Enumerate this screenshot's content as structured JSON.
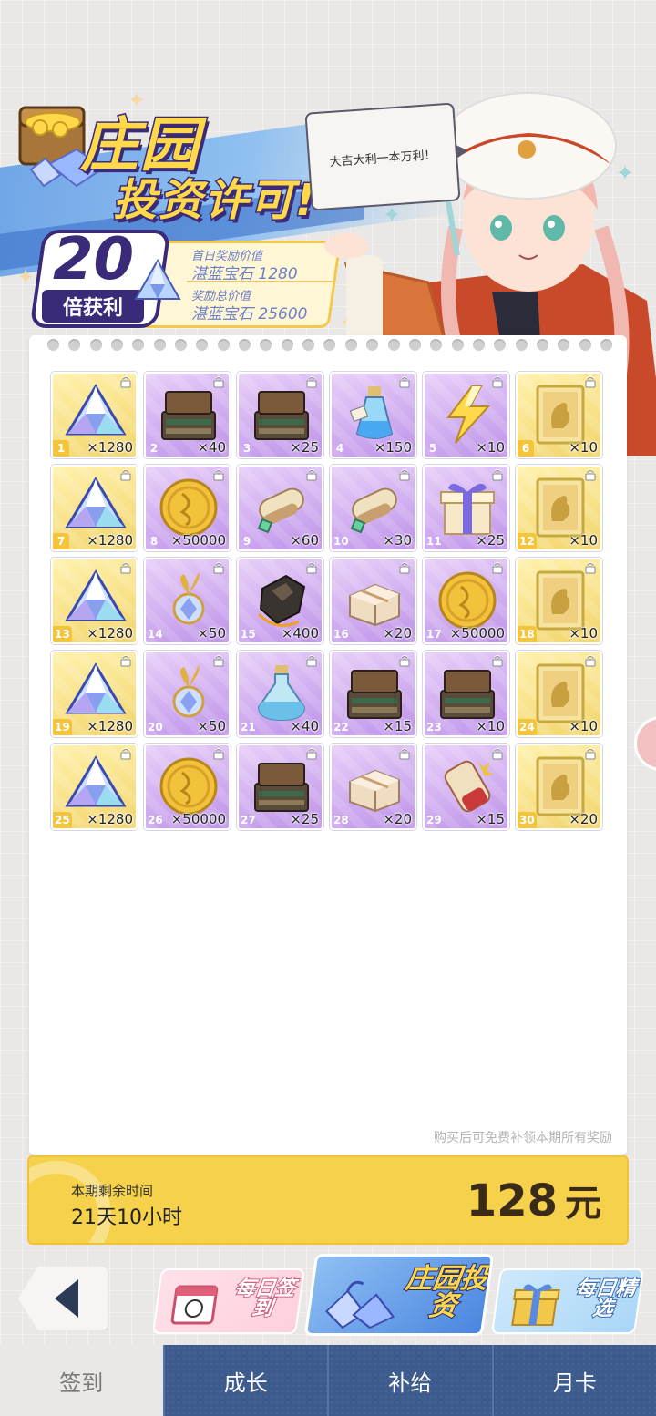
{
  "banner": {
    "title_line1": "庄园",
    "title_line2": "投资许可!",
    "multiplier": "20",
    "multiplier_label": "倍获利",
    "first_day_label": "首日奖励价值",
    "first_day_value": "湛蓝宝石 1280",
    "total_label": "奖励总价值",
    "total_value": "湛蓝宝石 25600"
  },
  "speech": "大吉大利一本万利！",
  "rewards": [
    {
      "idx": "1",
      "qty": "×1280",
      "icon": "blue-gem-icon",
      "bg": "gold"
    },
    {
      "idx": "2",
      "qty": "×40",
      "icon": "treasure-chest-icon",
      "bg": "purple"
    },
    {
      "idx": "3",
      "qty": "×25",
      "icon": "treasure-chest-icon",
      "bg": "purple"
    },
    {
      "idx": "4",
      "qty": "×150",
      "icon": "potion-bottle-icon",
      "bg": "purple"
    },
    {
      "idx": "5",
      "qty": "×10",
      "icon": "lightning-crystal-icon",
      "bg": "purple"
    },
    {
      "idx": "6",
      "qty": "×10",
      "icon": "gold-ticket-icon",
      "bg": "gold"
    },
    {
      "idx": "7",
      "qty": "×1280",
      "icon": "blue-gem-icon",
      "bg": "gold"
    },
    {
      "idx": "8",
      "qty": "×50000",
      "icon": "gold-coin-icon",
      "bg": "purple"
    },
    {
      "idx": "9",
      "qty": "×60",
      "icon": "scroll-bundle-icon",
      "bg": "purple"
    },
    {
      "idx": "10",
      "qty": "×30",
      "icon": "scroll-bundle-icon",
      "bg": "purple"
    },
    {
      "idx": "11",
      "qty": "×25",
      "icon": "gift-box-icon",
      "bg": "purple"
    },
    {
      "idx": "12",
      "qty": "×10",
      "icon": "gold-ticket-icon",
      "bg": "gold"
    },
    {
      "idx": "13",
      "qty": "×1280",
      "icon": "blue-gem-icon",
      "bg": "gold"
    },
    {
      "idx": "14",
      "qty": "×50",
      "icon": "crystal-amulet-icon",
      "bg": "purple"
    },
    {
      "idx": "15",
      "qty": "×400",
      "icon": "dark-ore-icon",
      "bg": "purple"
    },
    {
      "idx": "16",
      "qty": "×20",
      "icon": "parcel-icon",
      "bg": "purple"
    },
    {
      "idx": "17",
      "qty": "×50000",
      "icon": "gold-coin-icon",
      "bg": "purple"
    },
    {
      "idx": "18",
      "qty": "×10",
      "icon": "gold-ticket-icon",
      "bg": "gold"
    },
    {
      "idx": "19",
      "qty": "×1280",
      "icon": "blue-gem-icon",
      "bg": "gold"
    },
    {
      "idx": "20",
      "qty": "×50",
      "icon": "crystal-amulet-icon",
      "bg": "purple"
    },
    {
      "idx": "21",
      "qty": "×40",
      "icon": "potion-flask-icon",
      "bg": "purple"
    },
    {
      "idx": "22",
      "qty": "×15",
      "icon": "treasure-chest-icon",
      "bg": "purple"
    },
    {
      "idx": "23",
      "qty": "×10",
      "icon": "treasure-chest-icon",
      "bg": "purple"
    },
    {
      "idx": "24",
      "qty": "×10",
      "icon": "gold-ticket-icon",
      "bg": "gold"
    },
    {
      "idx": "25",
      "qty": "×1280",
      "icon": "blue-gem-icon",
      "bg": "gold"
    },
    {
      "idx": "26",
      "qty": "×50000",
      "icon": "gold-coin-icon",
      "bg": "purple"
    },
    {
      "idx": "27",
      "qty": "×25",
      "icon": "treasure-chest-icon",
      "bg": "purple"
    },
    {
      "idx": "28",
      "qty": "×20",
      "icon": "parcel-icon",
      "bg": "purple"
    },
    {
      "idx": "29",
      "qty": "×15",
      "icon": "red-scroll-icon",
      "bg": "purple"
    },
    {
      "idx": "30",
      "qty": "×20",
      "icon": "gold-ticket-icon",
      "bg": "gold"
    }
  ],
  "note": "购买后可免费补领本期所有奖励",
  "timer": {
    "label": "本期剩余时间",
    "value": "21天10小时",
    "price": "128",
    "currency": "元"
  },
  "features": {
    "daily_signin": "每日签到",
    "manor_invest": "庄园投资",
    "daily_pick": "每日精选"
  },
  "tabs": [
    "签到",
    "成长",
    "补给",
    "月卡"
  ],
  "colors": {
    "gold_bg": "#f2d56b",
    "purple_bg": "#bf94ea",
    "tab_blue": "#3e5b8e",
    "timer_yellow": "#f6d24c"
  }
}
